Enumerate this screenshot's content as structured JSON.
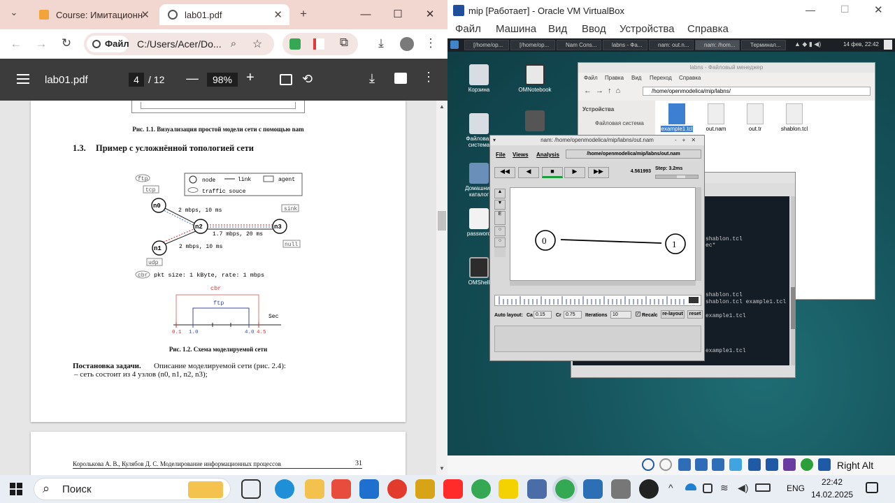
{
  "chrome": {
    "tabs": [
      {
        "title": "Course: Имитационн"
      },
      {
        "title": "lab01.pdf"
      }
    ],
    "address": {
      "scheme_label": "Файл",
      "url": "C:/Users/Acer/Do..."
    }
  },
  "pdf": {
    "file_name": "lab01.pdf",
    "page_current": "4",
    "page_total": "/ 12",
    "zoom": "98%",
    "caption_1_1": "Рис. 1.1. Визуализация простой модели сети с помощью nam",
    "section_number": "1.3.",
    "section_title": "Пример с усложнённой топологией сети",
    "legend": {
      "node": "node",
      "link": "link",
      "agent": "agent",
      "traffic": "traffic souce"
    },
    "nodes": [
      "n0",
      "n1",
      "n2",
      "n3"
    ],
    "agents": {
      "ftp": "ftp",
      "tcp": "tcp",
      "udp": "udp",
      "cbr": "cbr",
      "sink": "sink",
      "null": "null"
    },
    "links": {
      "n0": "2 mbps, 10 ms",
      "n1": "2 mbps, 10 ms",
      "n3": "1.7 mbps, 20 ms"
    },
    "pkt_info": "pkt size: 1 kByte, rate: 1 mbps",
    "timeline": {
      "cbr": "cbr",
      "ftp": "ftp",
      "axis": "Sec",
      "ticks_red_left": "0.1",
      "ticks_blue_left": "1.0",
      "ticks_blue_right": "4.0",
      "ticks_red_right": "4.5"
    },
    "caption_1_2": "Рис. 1.2. Схема моделируемой сети",
    "task_heading": "Постановка задачи.",
    "task_text": "Описание моделируемой сети (рис. 2.4):",
    "task_item": "–  сеть состоит из 4 узлов (n0, n1, n2, n3);",
    "footer_authors": "Королькова А. В., Кулябов Д. С. Моделирование информационных процессов",
    "footer_page": "31"
  },
  "vbox": {
    "title": "mip [Работает] - Oracle VM VirtualBox",
    "menu": [
      "Файл",
      "Машина",
      "Вид",
      "Ввод",
      "Устройства",
      "Справка"
    ],
    "host_key": "Right Alt"
  },
  "guest": {
    "panel_tasks": [
      "[/home/op...",
      "[/home/op...",
      "Nam Cons...",
      "labns - Фа...",
      "nam: out.n...",
      "nam: /hom...",
      "Терминал..."
    ],
    "panel_clock": "14 фев, 22:42",
    "desktop_icons": [
      {
        "label": "Корзина"
      },
      {
        "label": "OMNotebook"
      },
      {
        "label": "Файловая система"
      },
      {
        "label": "Домашний каталог"
      },
      {
        "label": "password"
      },
      {
        "label": "OMShell"
      }
    ],
    "file_manager": {
      "title": "labns - Файловый менеджер",
      "menu": [
        "Файл",
        "Правка",
        "Вид",
        "Переход",
        "Справка"
      ],
      "path": "/home/openmodelica/mip/labns/",
      "sidebar_heading": "Устройства",
      "sidebar_item": "Файловая система",
      "files": [
        "example1.tcl",
        "out.nam",
        "out.tr",
        "shablon.tcl"
      ]
    },
    "terminal": {
      "title": "...c/mip/labns",
      "lines": [
        "shablon.tcl",
        "ec*",
        "shablon.tcl",
        "shablon.tcl example1.tcl",
        "example1.tcl",
        "example1.tcl"
      ]
    },
    "nam": {
      "title": "nam: /home/openmodelica/mip/labns/out.nam",
      "menu": [
        "File",
        "Views",
        "Analysis"
      ],
      "path": "/home/openmodelica/mip/labns/out.nam",
      "time": "4.561993",
      "step": "Step: 3.2ms",
      "nodes": [
        "0",
        "1"
      ],
      "auto_layout": "Auto layout:",
      "ca_label": "Ca",
      "ca_value": "0.15",
      "cr_label": "Cr",
      "cr_value": "0.75",
      "iter_label": "Iterations",
      "iter_value": "10",
      "recalc": "Recalc",
      "relayout": "re-layout",
      "reset": "reset"
    }
  },
  "taskbar": {
    "search": "Поиск",
    "lang": "ENG",
    "time": "22:42",
    "date": "14.02.2025"
  }
}
